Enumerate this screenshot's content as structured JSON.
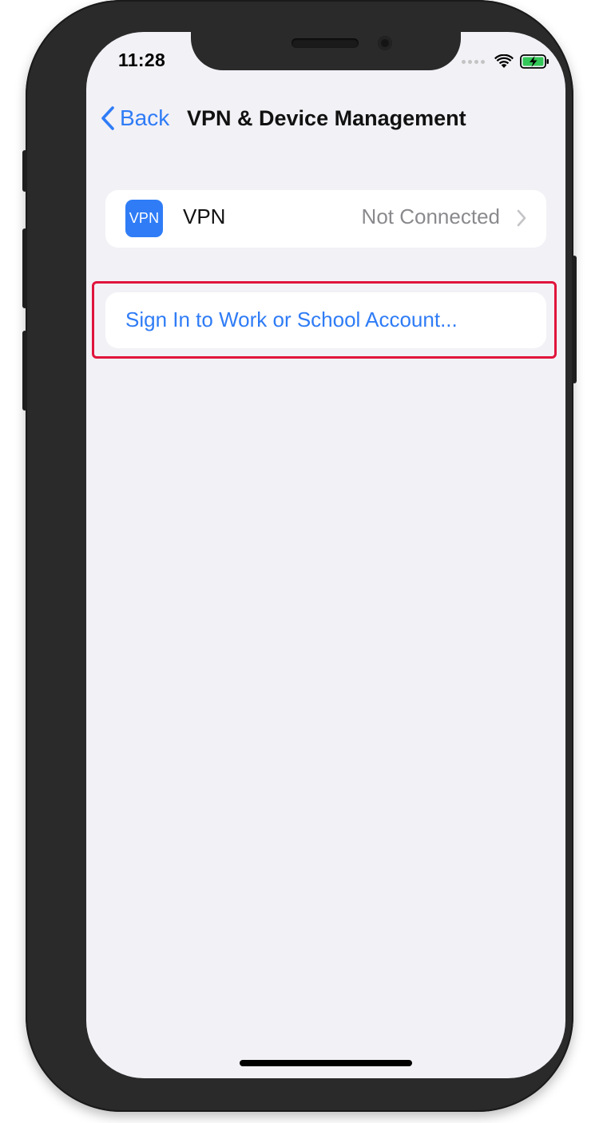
{
  "status_bar": {
    "time": "11:28",
    "icons": [
      "cellular-signal-icon",
      "wifi-icon",
      "battery-charging-icon"
    ]
  },
  "nav": {
    "back_label": "Back",
    "title": "VPN & Device Management"
  },
  "vpn_row": {
    "icon_text": "VPN",
    "label": "VPN",
    "status": "Not Connected"
  },
  "account_row": {
    "label": "Sign In to Work or School Account..."
  },
  "colors": {
    "accent": "#2f7cf6",
    "background": "#f2f1f6",
    "highlight": "#e0143c",
    "secondary_text": "#8a8a8e"
  }
}
